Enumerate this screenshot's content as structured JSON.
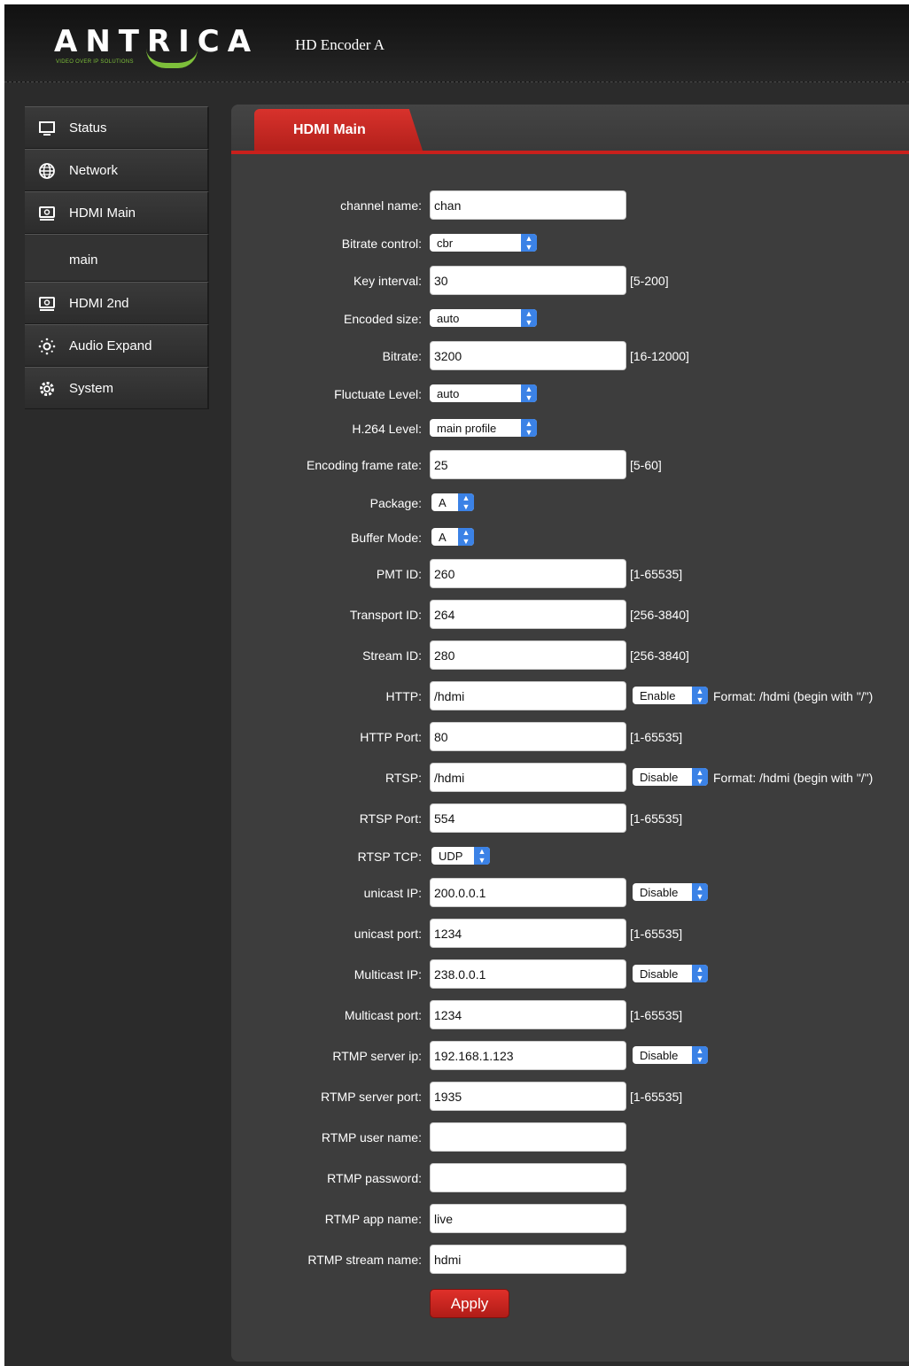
{
  "header": {
    "logo_text": "ANTRICA",
    "logo_tagline": "VIDEO OVER IP SOLUTIONS",
    "device_title": "HD Encoder  A"
  },
  "sidebar": {
    "items": [
      {
        "label": "Status",
        "icon": "monitor-icon"
      },
      {
        "label": "Network",
        "icon": "globe-icon"
      },
      {
        "label": "HDMI Main",
        "icon": "hdmi-device-icon"
      },
      {
        "label": "main",
        "icon": ""
      },
      {
        "label": "HDMI 2nd",
        "icon": "hdmi-device-icon"
      },
      {
        "label": "Audio Expand",
        "icon": "audio-icon"
      },
      {
        "label": "System",
        "icon": "gear-icon"
      }
    ]
  },
  "tab": {
    "label": "HDMI Main"
  },
  "form": {
    "channel_name": {
      "label": "channel name:",
      "value": "chan"
    },
    "bitrate_control": {
      "label": "Bitrate control:",
      "value": "cbr"
    },
    "key_interval": {
      "label": "Key interval:",
      "value": "30",
      "range": "[5-200]"
    },
    "encoded_size": {
      "label": "Encoded size:",
      "value": "auto"
    },
    "bitrate": {
      "label": "Bitrate:",
      "value": "3200",
      "range": "[16-12000]"
    },
    "fluctuate_level": {
      "label": "Fluctuate Level:",
      "value": "auto"
    },
    "h264_level": {
      "label": "H.264 Level:",
      "value": "main profile"
    },
    "frame_rate": {
      "label": "Encoding frame rate:",
      "value": "25",
      "range": "[5-60]"
    },
    "package": {
      "label": "Package:",
      "value": "A"
    },
    "buffer_mode": {
      "label": "Buffer Mode:",
      "value": "A"
    },
    "pmt_id": {
      "label": "PMT ID:",
      "value": "260",
      "range": "[1-65535]"
    },
    "transport_id": {
      "label": "Transport ID:",
      "value": "264",
      "range": "[256-3840]"
    },
    "stream_id": {
      "label": "Stream ID:",
      "value": "280",
      "range": "[256-3840]"
    },
    "http": {
      "label": "HTTP:",
      "value": "/hdmi",
      "mode": "Enable",
      "hint": "Format: /hdmi (begin with \"/\")"
    },
    "http_port": {
      "label": "HTTP Port:",
      "value": "80",
      "range": "[1-65535]"
    },
    "rtsp": {
      "label": "RTSP:",
      "value": "/hdmi",
      "mode": "Disable",
      "hint": "Format: /hdmi (begin with \"/\")"
    },
    "rtsp_port": {
      "label": "RTSP Port:",
      "value": "554",
      "range": "[1-65535]"
    },
    "rtsp_tcp": {
      "label": "RTSP TCP:",
      "value": "UDP"
    },
    "unicast_ip": {
      "label": "unicast IP:",
      "value": "200.0.0.1",
      "mode": "Disable"
    },
    "unicast_port": {
      "label": "unicast port:",
      "value": "1234",
      "range": "[1-65535]"
    },
    "multicast_ip": {
      "label": "Multicast IP:",
      "value": "238.0.0.1",
      "mode": "Disable"
    },
    "multicast_port": {
      "label": "Multicast port:",
      "value": "1234",
      "range": "[1-65535]"
    },
    "rtmp_server_ip": {
      "label": "RTMP server ip:",
      "value": "192.168.1.123",
      "mode": "Disable"
    },
    "rtmp_server_port": {
      "label": "RTMP server port:",
      "value": "1935",
      "range": "[1-65535]"
    },
    "rtmp_user_name": {
      "label": "RTMP user name:",
      "value": ""
    },
    "rtmp_password": {
      "label": "RTMP password:",
      "value": ""
    },
    "rtmp_app_name": {
      "label": "RTMP app name:",
      "value": "live"
    },
    "rtmp_stream_name": {
      "label": "RTMP stream name:",
      "value": "hdmi"
    },
    "apply_label": "Apply"
  },
  "colors": {
    "accent": "#c9201c",
    "panel": "#3d3d3d",
    "select_arrow": "#3b82e6",
    "logo_green": "#7dbf3a"
  }
}
